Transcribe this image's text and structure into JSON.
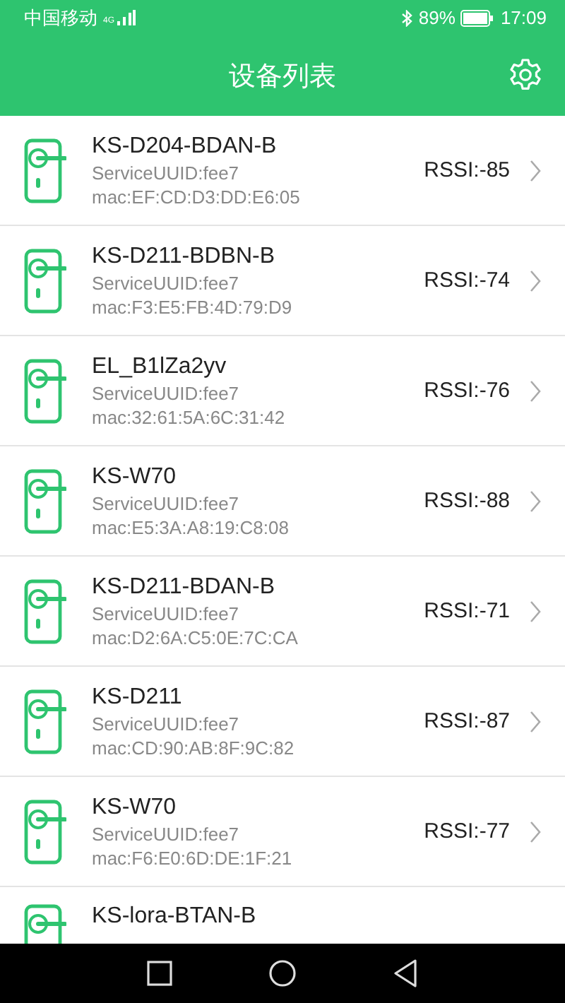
{
  "status_bar": {
    "carrier": "中国移动",
    "network": "4G",
    "battery": "89%",
    "time": "17:09"
  },
  "title": "设备列表",
  "devices": [
    {
      "name": "KS-D204-BDAN-B",
      "service": "ServiceUUID:fee7",
      "mac": "mac:EF:CD:D3:DD:E6:05",
      "rssi": "RSSI:-85"
    },
    {
      "name": "KS-D211-BDBN-B",
      "service": "ServiceUUID:fee7",
      "mac": "mac:F3:E5:FB:4D:79:D9",
      "rssi": "RSSI:-74"
    },
    {
      "name": "EL_B1lZa2yv",
      "service": "ServiceUUID:fee7",
      "mac": "mac:32:61:5A:6C:31:42",
      "rssi": "RSSI:-76"
    },
    {
      "name": "KS-W70",
      "service": "ServiceUUID:fee7",
      "mac": "mac:E5:3A:A8:19:C8:08",
      "rssi": "RSSI:-88"
    },
    {
      "name": "KS-D211-BDAN-B",
      "service": "ServiceUUID:fee7",
      "mac": "mac:D2:6A:C5:0E:7C:CA",
      "rssi": "RSSI:-71"
    },
    {
      "name": "KS-D211",
      "service": "ServiceUUID:fee7",
      "mac": "mac:CD:90:AB:8F:9C:82",
      "rssi": "RSSI:-87"
    },
    {
      "name": "KS-W70",
      "service": "ServiceUUID:fee7",
      "mac": "mac:F6:E0:6D:DE:1F:21",
      "rssi": "RSSI:-77"
    },
    {
      "name": "KS-lora-BTAN-B"
    }
  ]
}
